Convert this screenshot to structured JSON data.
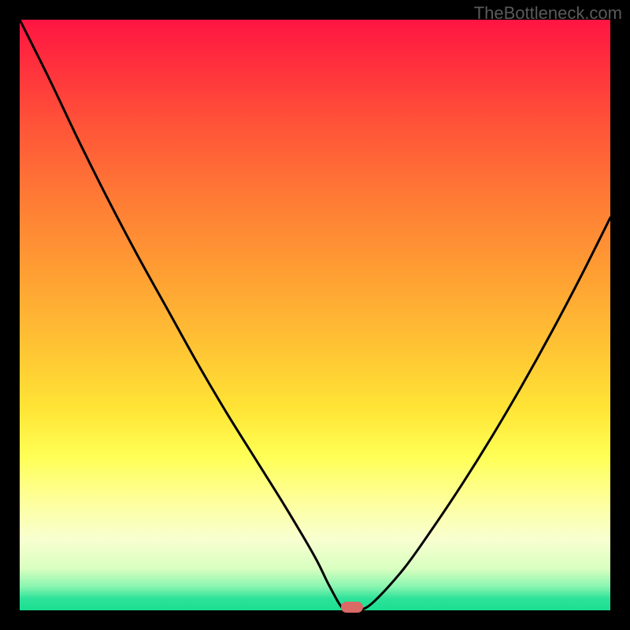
{
  "watermark": "TheBottleneck.com",
  "chart_data": {
    "type": "line",
    "title": "",
    "xlabel": "",
    "ylabel": "",
    "x": [
      0.0,
      0.05,
      0.1,
      0.15,
      0.2,
      0.25,
      0.3,
      0.35,
      0.4,
      0.45,
      0.5,
      0.525,
      0.55,
      0.575,
      0.6,
      0.65,
      0.7,
      0.75,
      0.8,
      0.85,
      0.9,
      0.95,
      1.0
    ],
    "values": [
      1.0,
      0.9,
      0.795,
      0.695,
      0.6,
      0.51,
      0.42,
      0.335,
      0.255,
      0.175,
      0.09,
      0.04,
      0.0,
      0.0,
      0.015,
      0.07,
      0.14,
      0.215,
      0.295,
      0.38,
      0.47,
      0.565,
      0.665
    ],
    "xlim": [
      0,
      1
    ],
    "ylim": [
      0,
      1
    ],
    "marker": {
      "x": 0.562,
      "y": 0.0
    },
    "gradient_stops": [
      {
        "pos": 0.0,
        "color": "#ff1543"
      },
      {
        "pos": 0.06,
        "color": "#ff2a3e"
      },
      {
        "pos": 0.18,
        "color": "#ff5438"
      },
      {
        "pos": 0.3,
        "color": "#ff7a35"
      },
      {
        "pos": 0.42,
        "color": "#ff9c33"
      },
      {
        "pos": 0.54,
        "color": "#ffbf34"
      },
      {
        "pos": 0.66,
        "color": "#ffe535"
      },
      {
        "pos": 0.74,
        "color": "#ffff56"
      },
      {
        "pos": 0.82,
        "color": "#fdffa0"
      },
      {
        "pos": 0.88,
        "color": "#f8ffd0"
      },
      {
        "pos": 0.93,
        "color": "#d8ffc0"
      },
      {
        "pos": 0.96,
        "color": "#88f5b0"
      },
      {
        "pos": 0.98,
        "color": "#2ee29a"
      },
      {
        "pos": 1.0,
        "color": "#1adf91"
      }
    ]
  }
}
